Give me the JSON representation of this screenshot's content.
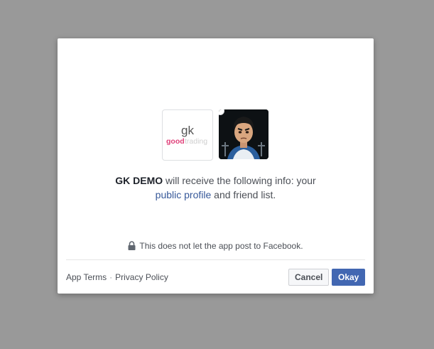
{
  "dialog": {
    "app_logo": {
      "monogram": "gk",
      "brand_word_1": "good",
      "brand_word_2": "trading",
      "brand_color": "#e0417a"
    },
    "info": {
      "app_name": "GK DEMO",
      "text_before_link": " will receive the following info: your",
      "link_text": "public profile",
      "text_after_link": " and friend list."
    },
    "notice": {
      "icon": "lock-icon",
      "text": "This does not let the app post to Facebook."
    },
    "footer": {
      "app_terms": "App Terms",
      "separator": "·",
      "privacy_policy": "Privacy Policy",
      "cancel_label": "Cancel",
      "okay_label": "Okay"
    },
    "colors": {
      "primary": "#4267b2",
      "link": "#365899",
      "overlay": "#999999"
    }
  }
}
